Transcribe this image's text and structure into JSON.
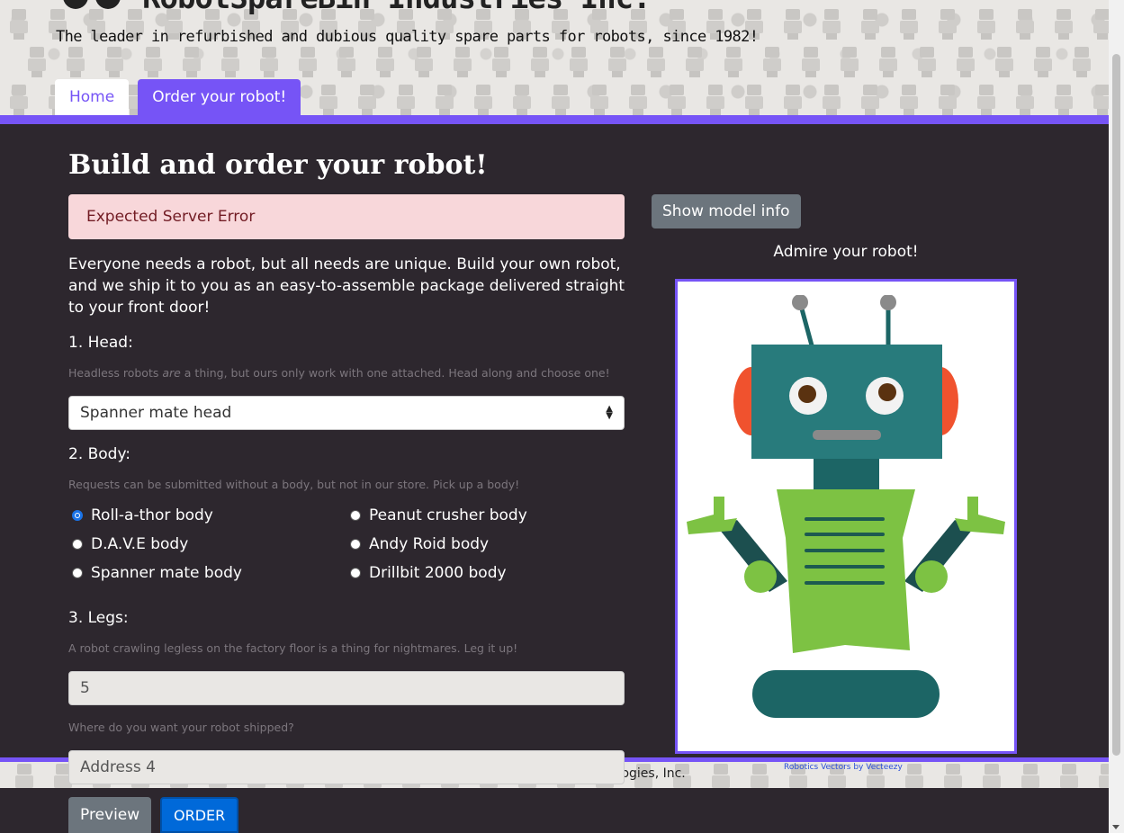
{
  "header": {
    "title": "RobotSpareBin Industries Inc.",
    "tagline": "The leader in refurbished and dubious quality spare parts for robots, since 1982!"
  },
  "tabs": [
    {
      "label": "Home",
      "active": false
    },
    {
      "label": "Order your robot!",
      "active": true
    }
  ],
  "main": {
    "title": "Build and order your robot!",
    "alert": "Expected Server Error",
    "intro": "Everyone needs a robot, but all needs are unique. Build your own robot, and we ship it to you as an easy-to-assemble package delivered straight to your front door!",
    "head": {
      "label": "1. Head:",
      "help_before": "Headless robots ",
      "help_em": "are",
      "help_after": " a thing, but ours only work with one attached. Head along and choose one!",
      "selected": "Spanner mate head"
    },
    "body": {
      "label": "2. Body:",
      "help": "Requests can be submitted without a body, but not in our store. Pick up a body!",
      "options": [
        {
          "label": "Roll-a-thor body",
          "checked": true
        },
        {
          "label": "Peanut crusher body",
          "checked": false
        },
        {
          "label": "D.A.V.E body",
          "checked": false
        },
        {
          "label": "Andy Roid body",
          "checked": false
        },
        {
          "label": "Spanner mate body",
          "checked": false
        },
        {
          "label": "Drillbit 2000 body",
          "checked": false
        }
      ]
    },
    "legs": {
      "label": "3. Legs:",
      "help": "A robot crawling legless on the factory floor is a thing for nightmares. Leg it up!",
      "value": "5"
    },
    "address": {
      "help": "Where do you want your robot shipped?",
      "value": "Address 4"
    },
    "buttons": {
      "preview": "Preview",
      "order": "ORDER"
    }
  },
  "sidebar": {
    "model_info_button": "Show model info",
    "admire": "Admire your robot!"
  },
  "footer": {
    "text": "ologies, Inc.",
    "credit": "Robotics Vectors by Vecteezy"
  },
  "colors": {
    "accent": "#7654f6",
    "background": "#2d272e",
    "robot_head": "#287b7c",
    "robot_body": "#7dc243",
    "robot_dark": "#1c6565",
    "robot_ears": "#f0522e"
  }
}
